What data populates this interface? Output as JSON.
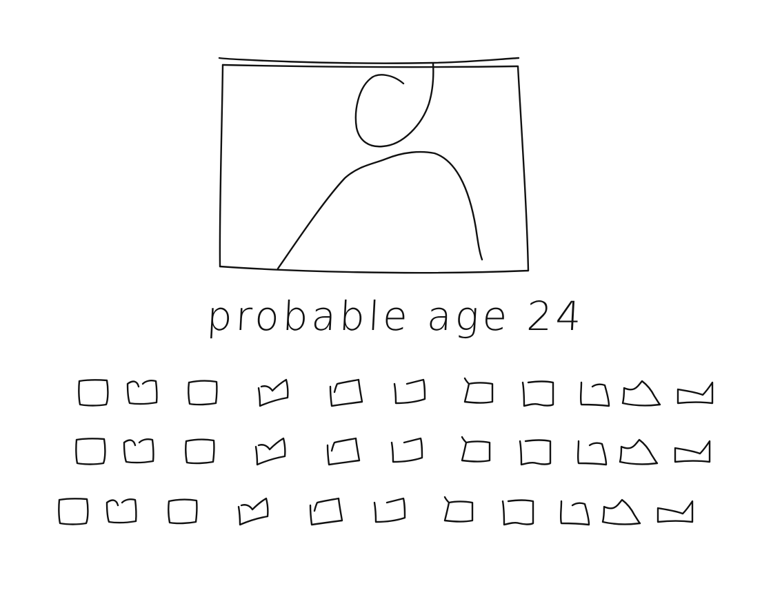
{
  "photo": {
    "placeholder_icon": "person-silhouette-icon"
  },
  "caption": {
    "text": "probable age 24"
  },
  "thumbnails": {
    "icon": "frame-placeholder-icon",
    "rows": [
      {
        "count": 11
      },
      {
        "count": 11
      },
      {
        "count": 11
      }
    ]
  }
}
